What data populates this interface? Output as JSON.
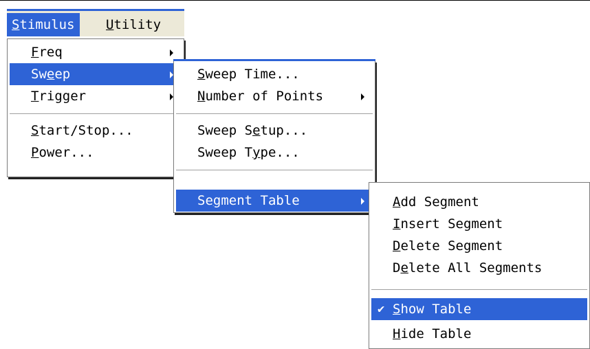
{
  "menubar": [
    {
      "pre": "",
      "acc": "S",
      "post": "timulus",
      "active": true
    },
    {
      "pre": "",
      "acc": "U",
      "post": "tility",
      "active": false
    }
  ],
  "stimulus_menu": [
    {
      "pre": "",
      "acc": "F",
      "post": "req",
      "submenu": true
    },
    {
      "pre": "Sw",
      "acc": "e",
      "post": "ep",
      "submenu": true,
      "selected": true
    },
    {
      "pre": "",
      "acc": "T",
      "post": "rigger",
      "submenu": true
    },
    {
      "pre": "",
      "acc": "S",
      "post": "tart/Stop...",
      "submenu": false
    },
    {
      "pre": "",
      "acc": "P",
      "post": "ower...",
      "submenu": false
    }
  ],
  "sweep_menu": [
    {
      "pre": "",
      "acc": "S",
      "post": "weep Time...",
      "submenu": false
    },
    {
      "pre": "",
      "acc": "N",
      "post": "umber of Points",
      "submenu": true
    },
    {
      "pre": "Sweep S",
      "acc": "e",
      "post": "tup...",
      "submenu": false
    },
    {
      "pre": "Sweep T",
      "acc": "y",
      "post": "pe...",
      "submenu": false
    },
    {
      "pre": "Se",
      "acc": "g",
      "post": "ment Table",
      "submenu": true,
      "selected": true
    }
  ],
  "segment_menu": [
    {
      "pre": "",
      "acc": "A",
      "post": "dd Segment"
    },
    {
      "pre": "",
      "acc": "I",
      "post": "nsert Segment"
    },
    {
      "pre": "",
      "acc": "D",
      "post": "elete Segment"
    },
    {
      "pre": "D",
      "acc": "e",
      "post": "lete All Segments"
    },
    {
      "pre": "",
      "acc": "S",
      "post": "how Table",
      "checked": true,
      "selected": true,
      "check_mark": "✔"
    },
    {
      "pre": "",
      "acc": "H",
      "post": "ide Table"
    }
  ],
  "colors": {
    "highlight": "#2e63d6",
    "menu_bg": "#ffffff",
    "menubar_bg": "#ece9d8"
  }
}
